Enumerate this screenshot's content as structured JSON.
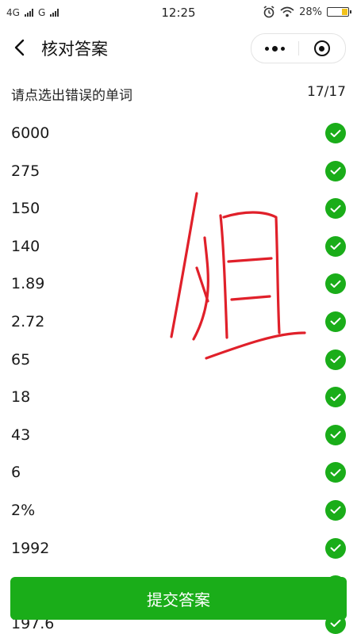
{
  "status_bar": {
    "network_1": "4G",
    "network_2": "G",
    "time": "12:25",
    "battery_percent": "28%",
    "battery_level": 0.28
  },
  "nav": {
    "title": "核对答案",
    "back_icon": "chevron-left-icon",
    "more_icon": "more-dots-icon",
    "close_icon": "target-circle-icon"
  },
  "header": {
    "instruction": "请点选出错误的单词",
    "progress": "17/17"
  },
  "items": [
    {
      "text": "6000",
      "status": "correct"
    },
    {
      "text": "275",
      "status": "correct"
    },
    {
      "text": "150",
      "status": "correct"
    },
    {
      "text": "140",
      "status": "correct"
    },
    {
      "text": "1.89",
      "status": "correct"
    },
    {
      "text": "2.72",
      "status": "correct"
    },
    {
      "text": "65",
      "status": "correct"
    },
    {
      "text": "18",
      "status": "correct"
    },
    {
      "text": "43",
      "status": "correct"
    },
    {
      "text": "6",
      "status": "correct"
    },
    {
      "text": "2%",
      "status": "correct"
    },
    {
      "text": "1992",
      "status": "correct"
    },
    {
      "text": "",
      "status": "correct"
    },
    {
      "text": "197.6",
      "status": "correct"
    }
  ],
  "submit": {
    "label": "提交答案"
  },
  "colors": {
    "accent": "#1aad19",
    "scribble": "#e0202a",
    "battery": "#f2c21b"
  }
}
